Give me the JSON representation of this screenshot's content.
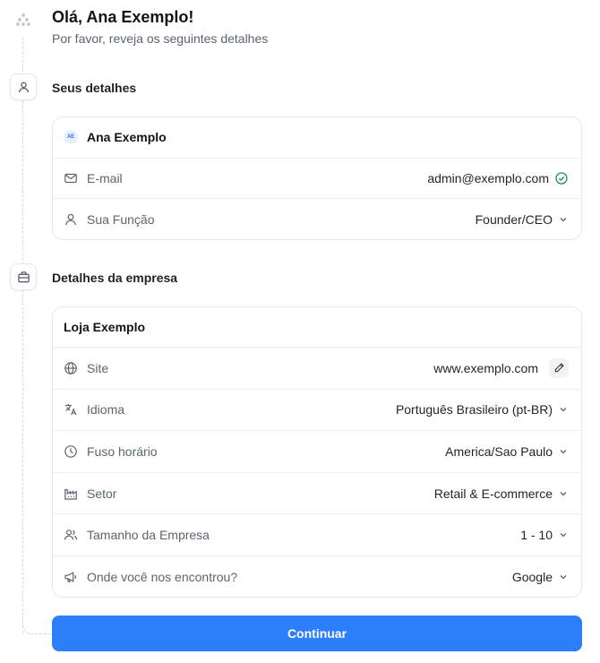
{
  "header": {
    "greeting": "Olá, Ana Exemplo!",
    "subtitle": "Por favor, reveja os seguintes detalhes"
  },
  "personal": {
    "title": "Seus detalhes",
    "name": "Ana Exemplo",
    "avatar_initials": "AE",
    "email_label": "E-mail",
    "email_value": "admin@exemplo.com",
    "role_label": "Sua Função",
    "role_value": "Founder/CEO"
  },
  "company": {
    "title": "Detalhes da empresa",
    "name": "Loja Exemplo",
    "site_label": "Site",
    "site_value": "www.exemplo.com",
    "language_label": "Idioma",
    "language_value": "Português Brasileiro (pt-BR)",
    "timezone_label": "Fuso horário",
    "timezone_value": "America/Sao Paulo",
    "sector_label": "Setor",
    "sector_value": "Retail & E-commerce",
    "size_label": "Tamanho da Empresa",
    "size_value": "1 - 10",
    "source_label": "Onde você nos encontrou?",
    "source_value": "Google"
  },
  "actions": {
    "continue_label": "Continuar"
  },
  "colors": {
    "primary": "#2d7ff9",
    "verified": "#1a8f5a",
    "muted": "#5b6470"
  }
}
